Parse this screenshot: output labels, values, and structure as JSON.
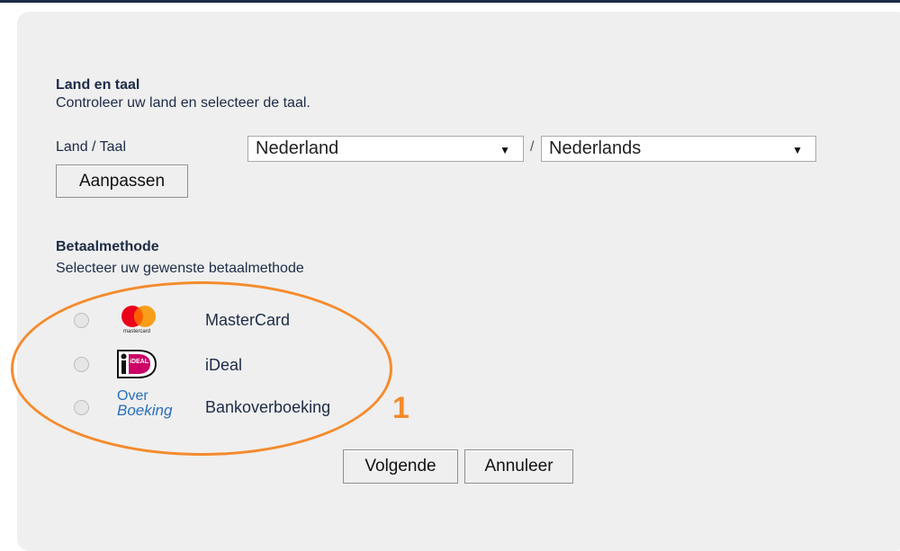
{
  "land_taal": {
    "title": "Land en taal",
    "description": "Controleer uw land en selecteer de taal.",
    "field_label": "Land / Taal",
    "country_value": "Nederland",
    "separator": "/",
    "language_value": "Nederlands",
    "apply_button": "Aanpassen"
  },
  "betaalmethode": {
    "title": "Betaalmethode",
    "description": "Selecteer uw gewenste betaalmethode",
    "methods": [
      {
        "label": "MasterCard",
        "logo": "mastercard-logo",
        "logo_text": "mastercard"
      },
      {
        "label": "iDeal",
        "logo": "ideal-logo",
        "logo_text": "iDEAL"
      },
      {
        "label": "Bankoverboeking",
        "logo": "overboeking-logo",
        "logo_line1": "Over",
        "logo_line2": "Boeking"
      }
    ]
  },
  "actions": {
    "next": "Volgende",
    "cancel": "Annuleer"
  },
  "annotation": {
    "step": "1",
    "color": "#f58b2d"
  },
  "colors": {
    "text": "#1d2b47",
    "panel": "#efefef",
    "mastercard_red": "#eb001b",
    "mastercard_orange": "#f79e1b",
    "ideal_pink": "#cc0066",
    "overboeking_blue": "#2a6ebb"
  }
}
